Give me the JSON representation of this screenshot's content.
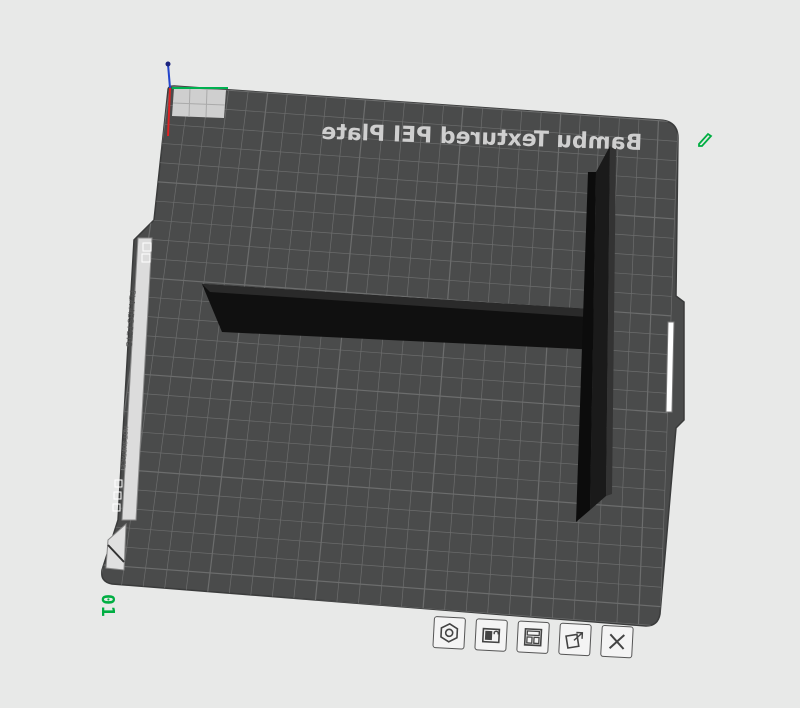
{
  "plate": {
    "label": "Bambu Textured PEI Plate",
    "number": "01",
    "side_label": "PLA ABS PETG",
    "hot_label": "HOT SURFACE"
  },
  "icons": {
    "edit": "pencil-icon",
    "toolbar": [
      "settings-hex-icon",
      "lock-plate-icon",
      "arrange-icon",
      "auto-orient-icon",
      "close-icon"
    ]
  },
  "colors": {
    "accent": "#00ae42",
    "plate": "#4a4b4b",
    "grid": "#6c6d6d",
    "object": "#111111"
  }
}
